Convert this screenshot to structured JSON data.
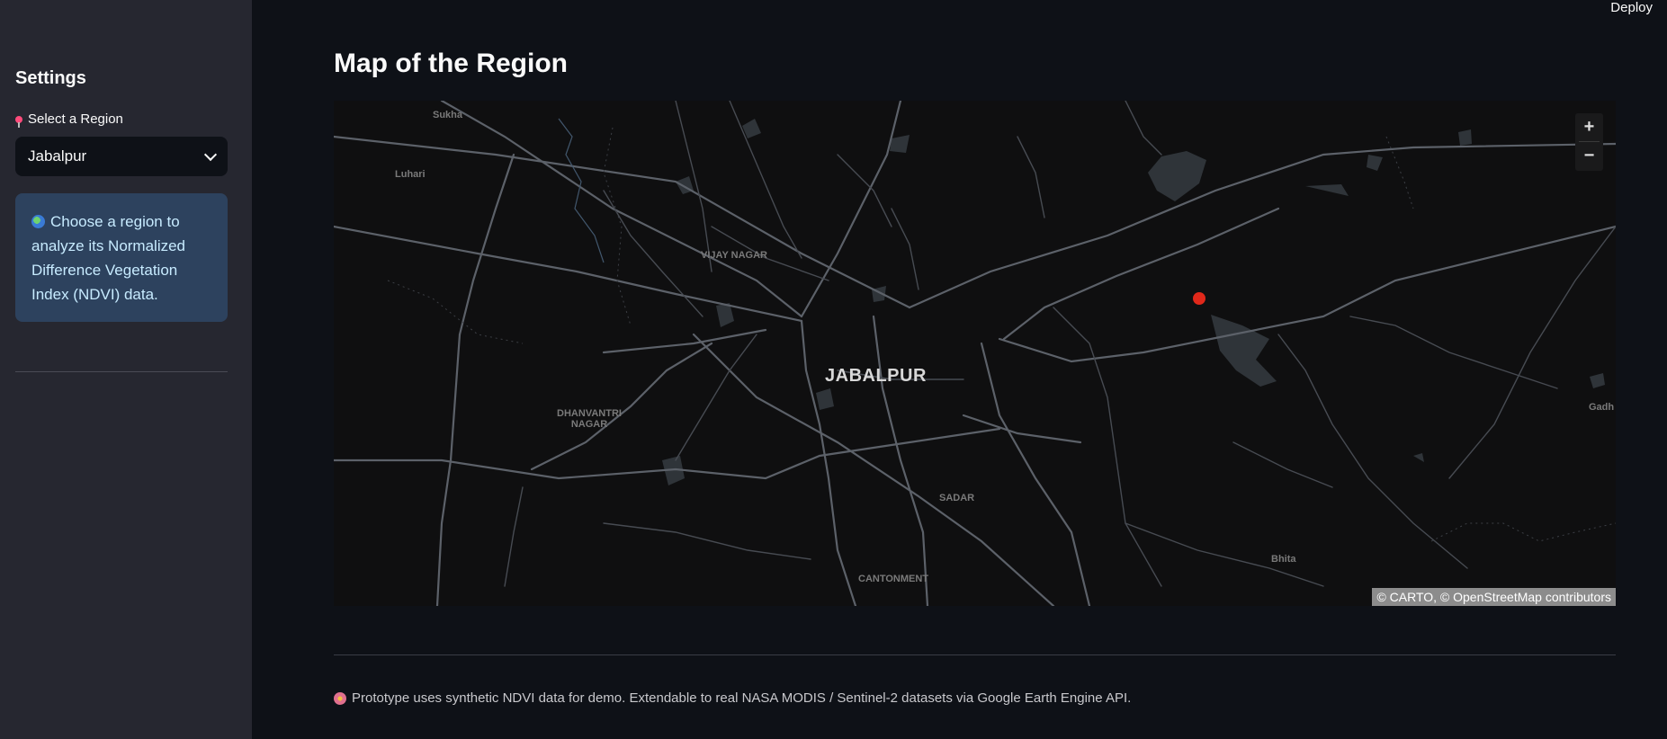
{
  "header": {
    "deploy_label": "Deploy"
  },
  "sidebar": {
    "title": "Settings",
    "select_label": "Select a Region",
    "select_value": "Jabalpur",
    "info_text": "Choose a region to analyze its Normalized Difference Vegetation Index (NDVI) data."
  },
  "main": {
    "title": "Map of the Region",
    "map": {
      "city_label": "JABALPUR",
      "place_labels": {
        "sukha": "Sukha",
        "luhari": "Luhari",
        "vijay_nagar": "VIJAY NAGAR",
        "dhanvantri_nagar": "DHANVANTRI NAGAR",
        "sadar": "SADAR",
        "cantonment": "CANTONMENT",
        "bhita": "Bhita",
        "gadh": "Gadh"
      },
      "zoom_in": "+",
      "zoom_out": "−",
      "attribution": "© CARTO, © OpenStreetMap contributors"
    },
    "footer_text": "Prototype uses synthetic NDVI data for demo. Extendable to real NASA MODIS / Sentinel-2 datasets via Google Earth Engine API."
  },
  "colors": {
    "background": "#0e1117",
    "sidebar": "#262730",
    "info_box": "#2d425e",
    "marker": "#e0281a"
  }
}
